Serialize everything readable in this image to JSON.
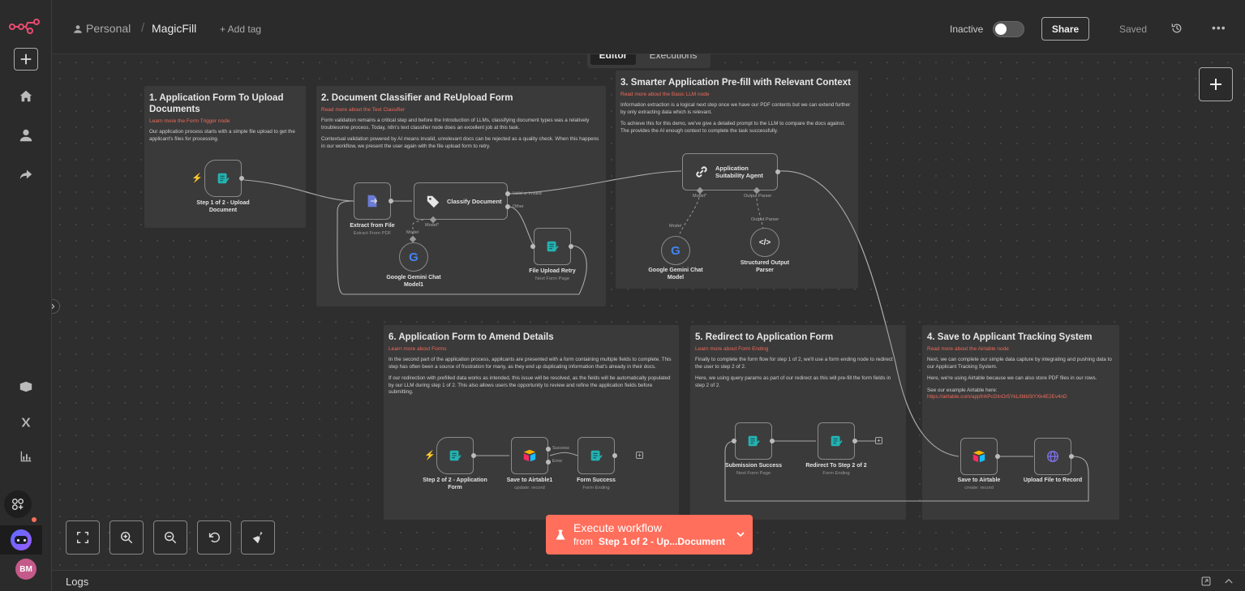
{
  "header": {
    "workspace": "Personal",
    "workflow_name": "MagicFill",
    "add_tag": "+ Add tag",
    "status_label": "Inactive",
    "share_label": "Share",
    "saved_label": "Saved"
  },
  "tabs": {
    "editor": "Editor",
    "executions": "Executions"
  },
  "sticky_notes": [
    {
      "title": "1. Application Form To Upload Documents",
      "link": "Learn more the Form Trigger node",
      "body": "Our application process starts with a simple file upload to get the applicant's files for processing."
    },
    {
      "title": "2. Document Classifier and ReUpload Form",
      "link": "Read more about the Text Classifier",
      "body1": "Form validation remains a critical step and before the Introduction of LLMs, classifying document types was a relatively troublesome process. Today, n8n's text classifier node does an excellent job at this task.",
      "body2": "Contextual validation powered by AI means invalid, unrelevant docs can be rejected as a quality check. When this happens in our workflow, we present the user again with the file upload form to retry."
    },
    {
      "title": "3. Smarter Application Pre-fill with Relevant Context",
      "link": "Read more about the Basic LLM node",
      "body1": "Information extraction is a logical next step once we have our PDF contents but we can extend further by only extracting data which is relevant.",
      "body2": "To achieve this for this demo, we've give a detailed prompt to the LLM to compare the docs against. The provides the AI enough context to complete the task successfully."
    },
    {
      "title": "6. Application Form to Amend Details",
      "link": "Learn more about Forms",
      "body1": "In the second part of the application process, applicants are presented with a form containing multiple fields to complete. This step has often been a source of frustration for many, as they end up duplicating information that's already in their docs.",
      "body2": "If our redirection with prefilled data works as intended, this issue will be resolved, as the fields will be automatically populated by our LLM during step 1 of 2. This also allows users the opportunity to review and refine the application fields before submitting."
    },
    {
      "title": "5. Redirect to Application Form",
      "link": "Learn more about Form Ending",
      "body1": "Finally to complete the form flow for step 1 of 2, we'll use a form ending node to redirect the user to step 2 of 2.",
      "body2": "Here, we using query params as part of our redirect as this will pre-fill the form fields in step 2 of 2."
    },
    {
      "title": "4. Save to Applicant Tracking System",
      "link": "Read more about the Airtable node",
      "body1": "Next, we can complete our simple data capture by integrating and pushing data to our Applicant Tracking System.",
      "body2": "Here, we're using Airtable because we can also store PDF files in our rows.",
      "body3": "See our example Airtable here:",
      "url": "https://airtable.com/appfnhPcGtnOr5YkL/tblbStYXk4E2Ev4nD"
    }
  ],
  "nodes": {
    "step1": {
      "label": "Step 1 of 2 - Upload Document"
    },
    "extract": {
      "label": "Extract from File",
      "sub": "Extract From PDF"
    },
    "classify": {
      "label": "Classify Document"
    },
    "gemini1": {
      "label": "Google Gemini Chat Model1"
    },
    "retry": {
      "label": "File Upload Retry",
      "sub": "Next Form Page"
    },
    "agent": {
      "label": "Application Suitability Agent"
    },
    "gemini2": {
      "label": "Google Gemini Chat Model"
    },
    "parser": {
      "label": "Structured Output Parser"
    },
    "step2": {
      "label": "Step 2 of 2 - Application Form"
    },
    "airtable1": {
      "label": "Save to Airtable1",
      "sub": "update: record"
    },
    "formsuccess": {
      "label": "Form Success",
      "sub": "Form Ending"
    },
    "subsuccess": {
      "label": "Submission Success",
      "sub": "Next Form Page"
    },
    "redirect": {
      "label": "Redirect To Step 2 of 2",
      "sub": "Form Ending"
    },
    "airtable2": {
      "label": "Save to Airtable",
      "sub": "create: record"
    },
    "upload": {
      "label": "Upload File to Record"
    }
  },
  "port_labels": {
    "valid": "Valid or Invalid",
    "other": "Other",
    "model": "Model",
    "model_req": "Model*",
    "output_parser": "Output Parser",
    "success": "Success",
    "error": "Error"
  },
  "execute": {
    "label": "Execute workflow",
    "sub_prefix": "from ",
    "sub_node": "Step 1 of 2 - Up...Document"
  },
  "logs": {
    "label": "Logs"
  },
  "avatar": {
    "initials": "BM"
  },
  "colors": {
    "accent": "#ff6f5c",
    "teal": "#24b3b3",
    "canvas": "#2e2e2e"
  }
}
